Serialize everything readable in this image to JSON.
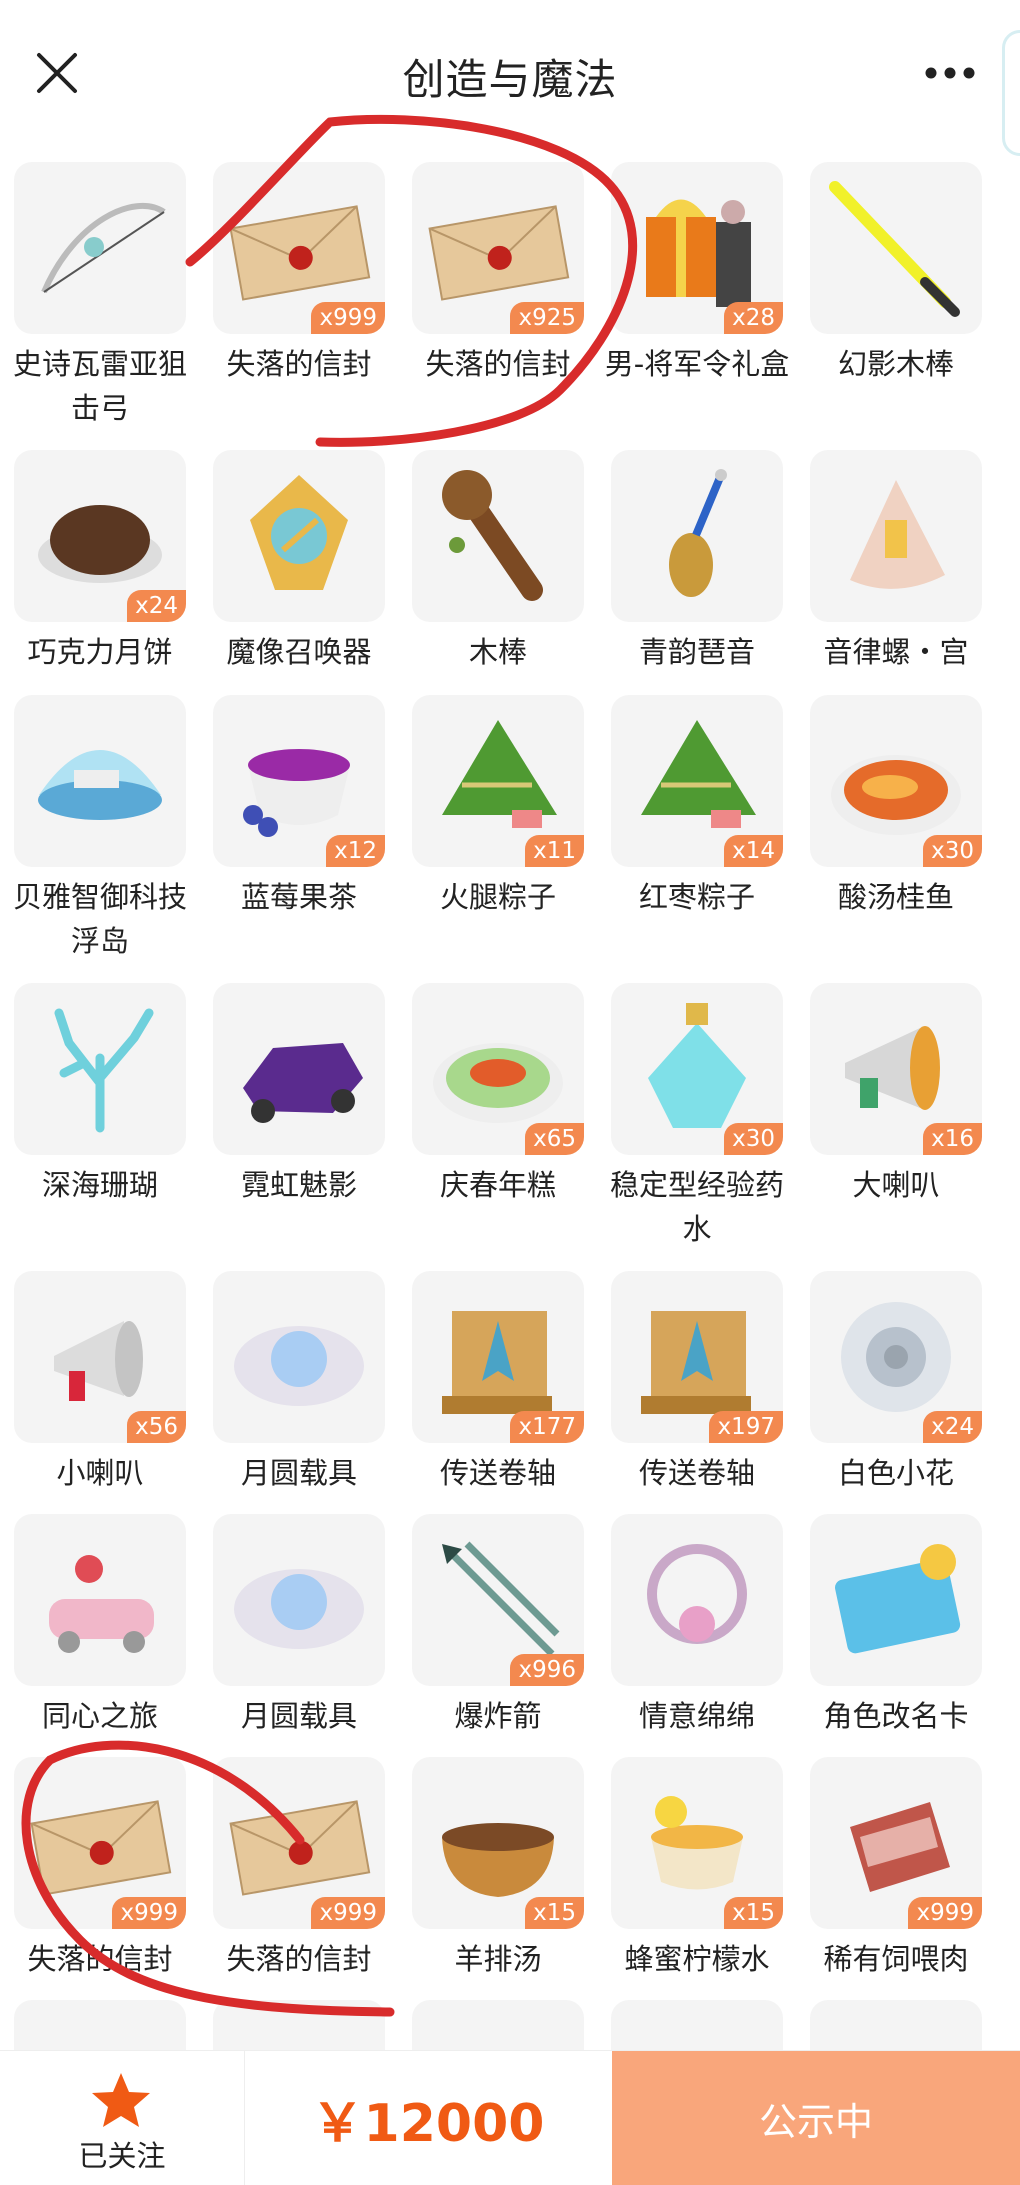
{
  "header": {
    "title": "创造与魔法"
  },
  "items": [
    {
      "label": "史诗瓦雷亚狙击弓",
      "count": "",
      "icon": "bow-icon"
    },
    {
      "label": "失落的信封",
      "count": "x999",
      "icon": "envelope-icon"
    },
    {
      "label": "失落的信封",
      "count": "x925",
      "icon": "envelope-icon"
    },
    {
      "label": "男-将军令礼盒",
      "count": "x28",
      "icon": "gift-box-icon"
    },
    {
      "label": "幻影木棒",
      "count": "",
      "icon": "lightsaber-icon"
    },
    {
      "label": "巧克力月饼",
      "count": "x24",
      "icon": "mooncake-icon"
    },
    {
      "label": "魔像召唤器",
      "count": "",
      "icon": "golem-summoner-icon"
    },
    {
      "label": "木棒",
      "count": "",
      "icon": "wooden-club-icon"
    },
    {
      "label": "青韵琶音",
      "count": "",
      "icon": "pipa-icon"
    },
    {
      "label": "音律螺・宫",
      "count": "",
      "icon": "conch-icon"
    },
    {
      "label": "贝雅智御科技浮岛",
      "count": "",
      "icon": "floating-island-icon"
    },
    {
      "label": "蓝莓果茶",
      "count": "x12",
      "icon": "blueberry-tea-icon"
    },
    {
      "label": "火腿粽子",
      "count": "x11",
      "icon": "zongzi-icon"
    },
    {
      "label": "红枣粽子",
      "count": "x14",
      "icon": "zongzi-icon"
    },
    {
      "label": "酸汤桂鱼",
      "count": "x30",
      "icon": "fish-soup-icon"
    },
    {
      "label": "深海珊瑚",
      "count": "",
      "icon": "coral-icon"
    },
    {
      "label": "霓虹魅影",
      "count": "",
      "icon": "neon-vehicle-icon"
    },
    {
      "label": "庆春年糕",
      "count": "x65",
      "icon": "rice-cake-icon"
    },
    {
      "label": "稳定型经验药水",
      "count": "x30",
      "icon": "potion-icon"
    },
    {
      "label": "大喇叭",
      "count": "x16",
      "icon": "megaphone-icon"
    },
    {
      "label": "小喇叭",
      "count": "x56",
      "icon": "small-megaphone-icon"
    },
    {
      "label": "月圆载具",
      "count": "",
      "icon": "moon-cloud-icon"
    },
    {
      "label": "传送卷轴",
      "count": "x177",
      "icon": "scroll-icon"
    },
    {
      "label": "传送卷轴",
      "count": "x197",
      "icon": "scroll-icon"
    },
    {
      "label": "白色小花",
      "count": "x24",
      "icon": "white-flower-icon"
    },
    {
      "label": "同心之旅",
      "count": "",
      "icon": "flower-car-icon"
    },
    {
      "label": "月圆载具",
      "count": "",
      "icon": "moon-cloud-icon"
    },
    {
      "label": "爆炸箭",
      "count": "x996",
      "icon": "arrows-icon"
    },
    {
      "label": "情意绵绵",
      "count": "",
      "icon": "ornament-icon"
    },
    {
      "label": "角色改名卡",
      "count": "",
      "icon": "rename-card-icon"
    },
    {
      "label": "失落的信封",
      "count": "x999",
      "icon": "envelope-icon"
    },
    {
      "label": "失落的信封",
      "count": "x999",
      "icon": "envelope-icon"
    },
    {
      "label": "羊排汤",
      "count": "x15",
      "icon": "soup-bowl-icon"
    },
    {
      "label": "蜂蜜柠檬水",
      "count": "x15",
      "icon": "lemon-tea-icon"
    },
    {
      "label": "稀有饲喂肉",
      "count": "x999",
      "icon": "meat-icon"
    }
  ],
  "bottom": {
    "follow_label": "已关注",
    "price": "￥12000",
    "status": "公示中"
  },
  "colors": {
    "accent": "#f05a14",
    "badge": "#f3894f",
    "status_bg": "#f9a67b",
    "annotation": "#d82b2b"
  }
}
